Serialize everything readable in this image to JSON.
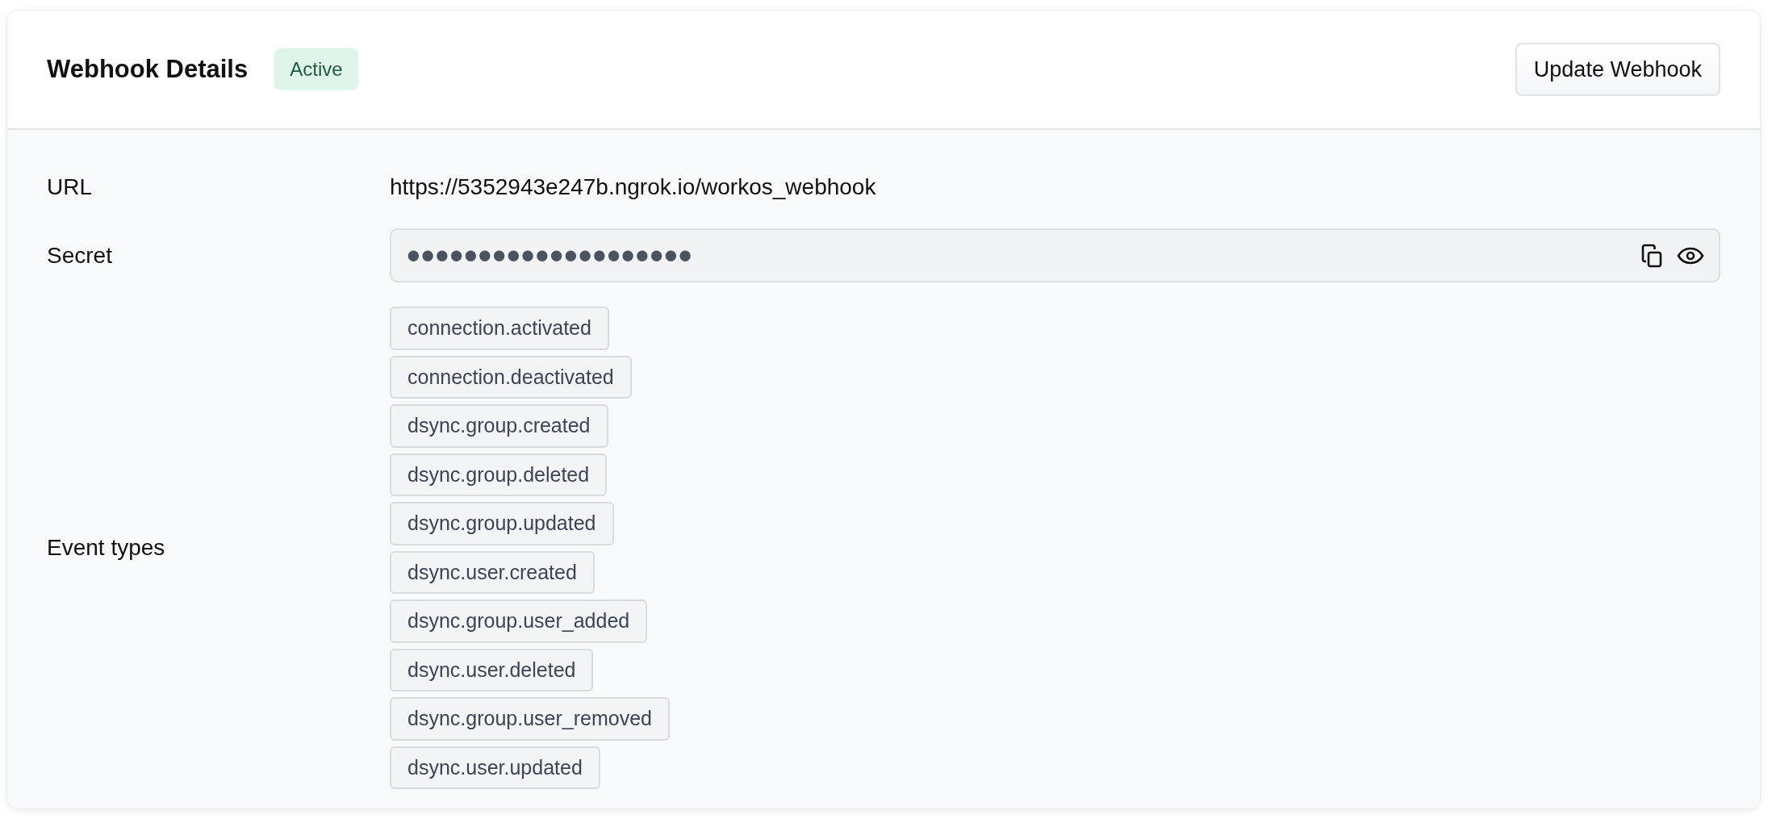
{
  "header": {
    "title": "Webhook Details",
    "status": "Active",
    "button": "Update Webhook"
  },
  "fields": [
    {
      "kind": "text",
      "label": "URL",
      "value": "https://5352943e247b.ngrok.io/workos_webhook"
    },
    {
      "kind": "secret",
      "label": "Secret",
      "value": "●●●●●●●●●●●●●●●●●●●●"
    },
    {
      "kind": "tags",
      "label": "Event types",
      "tags": [
        "connection.activated",
        "connection.deactivated",
        "dsync.group.created",
        "dsync.group.deleted",
        "dsync.group.updated",
        "dsync.user.created",
        "dsync.group.user_added",
        "dsync.user.deleted",
        "dsync.group.user_removed",
        "dsync.user.updated"
      ]
    }
  ]
}
